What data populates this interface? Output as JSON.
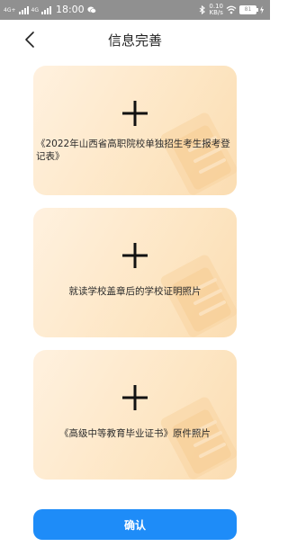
{
  "status_bar": {
    "signal_1": "4G+",
    "signal_2": "4G",
    "time": "18:00",
    "speed_value": "0.10",
    "speed_unit": "KB/s",
    "battery": "81"
  },
  "header": {
    "title": "信息完善",
    "back_icon": "chevron-left-icon"
  },
  "cards": [
    {
      "label": "《2022年山西省高职院校单独招生考生报考登记表》",
      "icon": "plus-icon"
    },
    {
      "label": "就读学校盖章后的学校证明照片",
      "icon": "plus-icon"
    },
    {
      "label": "《高级中等教育毕业证书》原件照片",
      "icon": "plus-icon"
    }
  ],
  "confirm_button": {
    "label": "确认"
  },
  "colors": {
    "accent": "#1e8cf8",
    "card_background": "#fde6c4",
    "status_bar": "#909090"
  }
}
